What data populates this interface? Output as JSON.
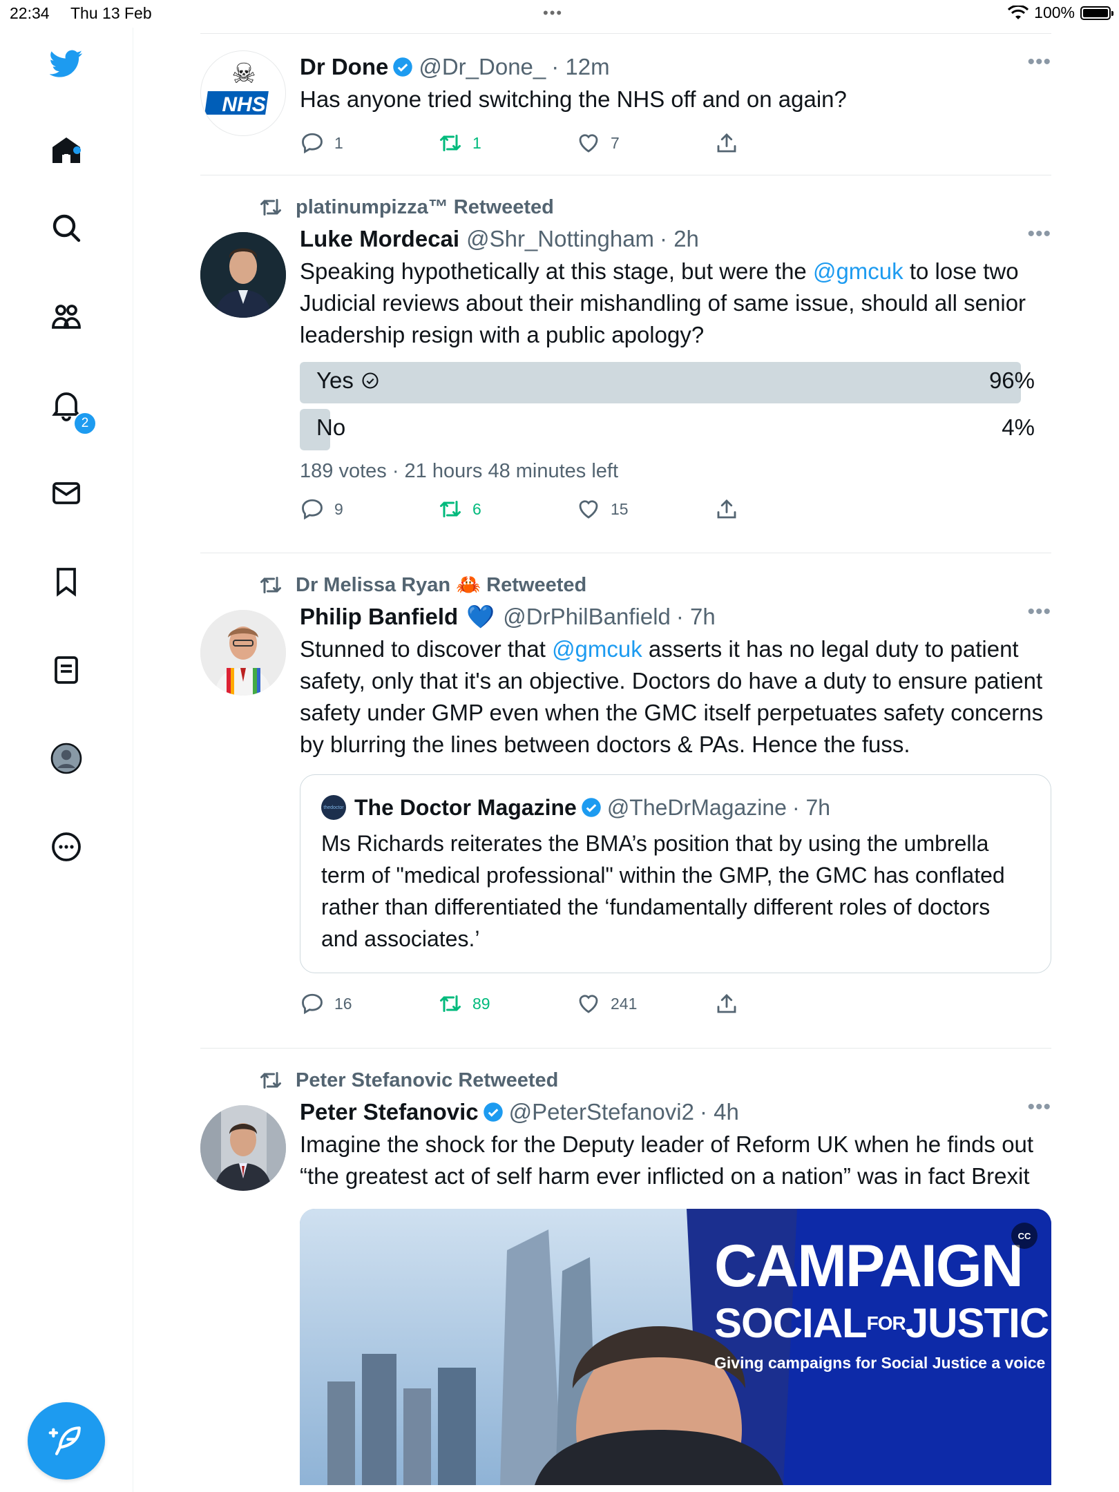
{
  "status_bar": {
    "time": "22:34",
    "date": "Thu 13 Feb",
    "battery": "100%"
  },
  "sidebar": {
    "items": [
      "twitter-logo",
      "home",
      "search",
      "communities",
      "notifications",
      "messages",
      "bookmarks",
      "lists",
      "profile",
      "more"
    ],
    "notification_count": "2"
  },
  "colors": {
    "accent": "#1d9bf0",
    "retweet": "#00ba7c",
    "secondary": "#536471"
  },
  "tweets": [
    {
      "name": "Dr Done",
      "handle": "@Dr_Done_",
      "time": "· 12m",
      "text": "Has anyone tried switching the NHS off and on again?",
      "replies": "1",
      "retweets": "1",
      "likes": "7"
    },
    {
      "retweeted_by": "platinumpizza™ Retweeted",
      "name": "Luke Mordecai",
      "handle": "@Shr_Nottingham",
      "time": "· 2h",
      "text_pre": "Speaking hypothetically at this stage, but were the ",
      "mention": "@gmcuk",
      "text_post": " to lose two Judicial reviews about their mishandling of same issue, should all senior leadership resign with a public apology?",
      "poll": {
        "options": [
          {
            "label": "Yes",
            "percent": "96%",
            "fraction": 0.96
          },
          {
            "label": "No",
            "percent": "4%",
            "fraction": 0.04
          }
        ],
        "meta": "189 votes · 21 hours 48 minutes left"
      },
      "replies": "9",
      "retweets": "6",
      "likes": "15"
    },
    {
      "retweeted_by_name": "Dr Melissa Ryan",
      "retweeted_by_suffix": "Retweeted",
      "retweeted_by_emoji": "🦀",
      "name": "Philip Banfield",
      "name_emoji": "💙",
      "handle": "@DrPhilBanfield",
      "time": "· 7h",
      "text_pre": "Stunned to discover that ",
      "mention": "@gmcuk",
      "text_post": " asserts it has no legal duty to patient safety, only that it's an objective. Doctors do have a duty to ensure patient safety under GMP even when the GMC itself perpetuates safety concerns by blurring the lines between doctors & PAs. Hence the fuss.",
      "quote": {
        "name": "The Doctor Magazine",
        "handle": "@TheDrMagazine",
        "time": "· 7h",
        "avatar_text": "thedoctor",
        "text": "Ms Richards reiterates the BMA’s position that by using the umbrella term of \"medical professional\" within the GMP, the GMC has conflated rather than differentiated the ‘fundamentally different roles of doctors and associates.’"
      },
      "replies": "16",
      "retweets": "89",
      "likes": "241"
    },
    {
      "retweeted_by": "Peter Stefanovic Retweeted",
      "name": "Peter Stefanovic",
      "handle": "@PeterStefanovi2",
      "time": "· 4h",
      "text": "Imagine the shock for the Deputy leader of Reform UK when he finds out “the greatest act of self harm ever inflicted on a nation” was in fact Brexit",
      "media": {
        "line1": "CAMPAIGN",
        "line2a": "SOCIAL",
        "line2b": "FOR",
        "line2c": "JUSTICE",
        "line3": "Giving campaigns for Social Justice a voice",
        "cc": "CC"
      }
    }
  ]
}
